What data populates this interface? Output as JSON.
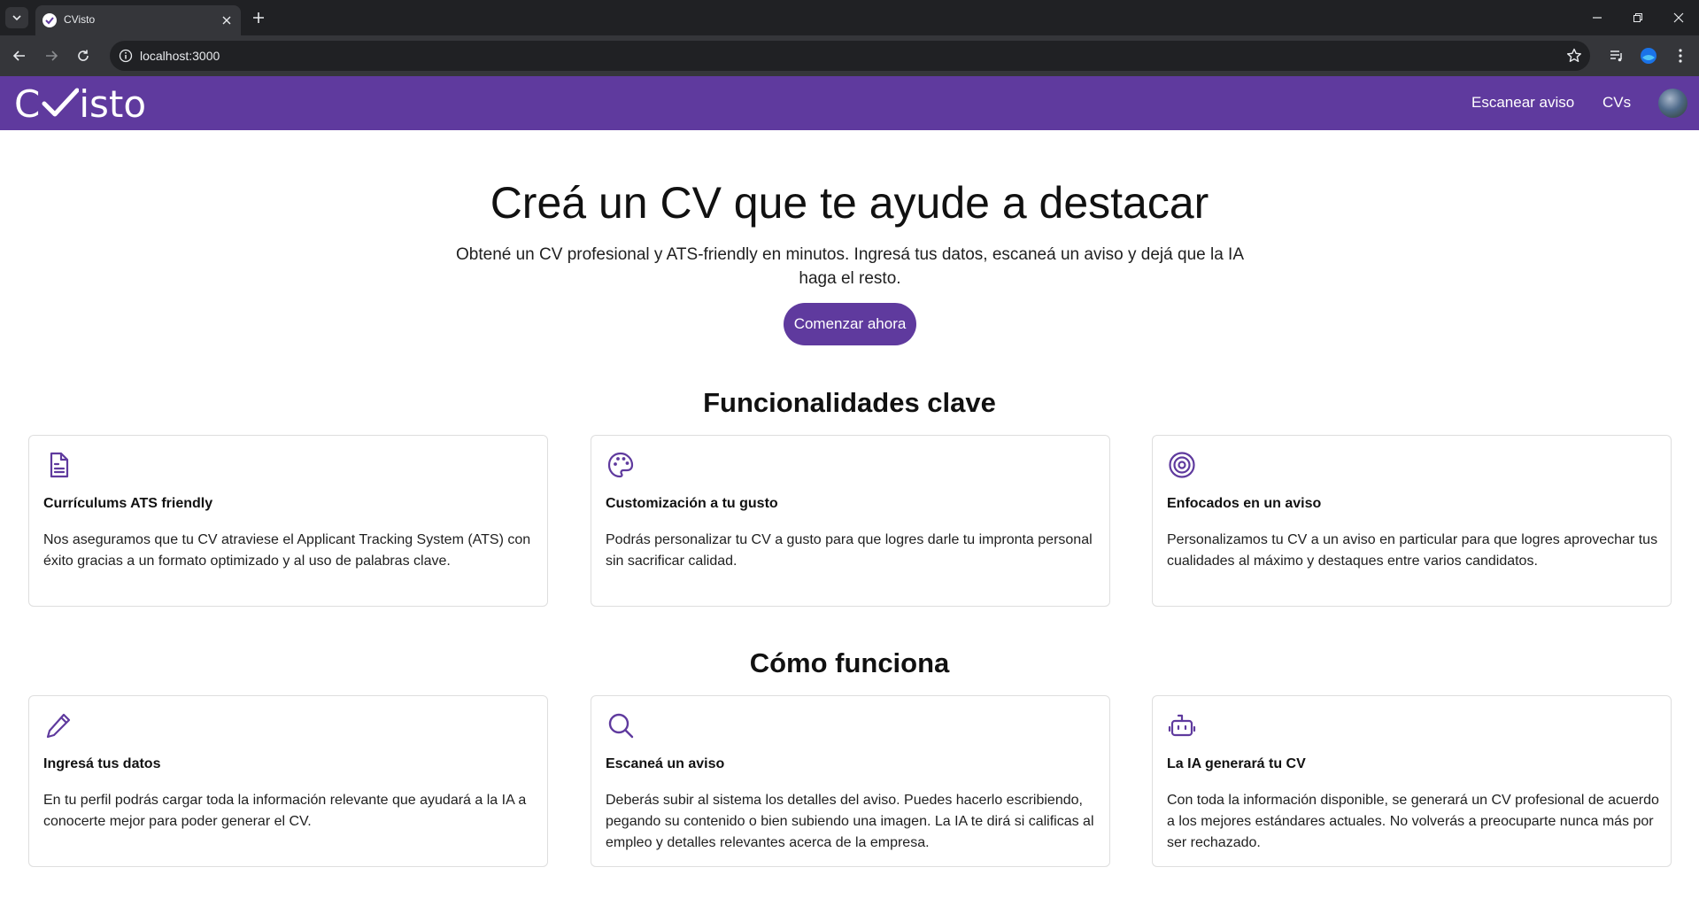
{
  "browser": {
    "tab_title": "CVisto",
    "url": "localhost:3000"
  },
  "header": {
    "logo_c": "C",
    "logo_rest": "isto",
    "nav": {
      "scan": "Escanear aviso",
      "cvs": "CVs"
    }
  },
  "hero": {
    "title": "Creá un CV que te ayude a destacar",
    "subtitle": "Obtené un CV profesional y ATS-friendly en minutos. Ingresá tus datos, escaneá un aviso y dejá que la IA haga el resto.",
    "cta": "Comenzar ahora"
  },
  "features": {
    "title": "Funcionalidades clave",
    "items": [
      {
        "icon": "document-icon",
        "title": "Currículums ATS friendly",
        "text": "Nos aseguramos que tu CV atraviese el Applicant Tracking System (ATS) con éxito gracias a un formato optimizado y al uso de palabras clave."
      },
      {
        "icon": "palette-icon",
        "title": "Customización a tu gusto",
        "text": "Podrás personalizar tu CV a gusto para que logres darle tu impronta personal sin sacrificar calidad."
      },
      {
        "icon": "target-icon",
        "title": "Enfocados en un aviso",
        "text": "Personalizamos tu CV a un aviso en particular para que logres aprovechar tus cualidades al máximo y destaques entre varios candidatos."
      }
    ]
  },
  "how": {
    "title": "Cómo funciona",
    "items": [
      {
        "icon": "pencil-icon",
        "title": "Ingresá tus datos",
        "text": "En tu perfil podrás cargar toda la información relevante que ayudará a la IA a conocerte mejor para poder generar el CV."
      },
      {
        "icon": "search-icon",
        "title": "Escaneá un aviso",
        "text": "Deberás subir al sistema los detalles del aviso. Puedes hacerlo escribiendo, pegando su contenido o bien subiendo una imagen. La IA te dirá si calificas al empleo y detalles relevantes acerca de la empresa."
      },
      {
        "icon": "robot-icon",
        "title": "La IA generará tu CV",
        "text": "Con toda la información disponible, se generará un CV profesional de acuerdo a los mejores estándares actuales. No volverás a preocuparte nunca más por ser rechazado."
      }
    ]
  },
  "colors": {
    "brand": "#5f3a9e",
    "chrome_dark": "#202124",
    "chrome_mid": "#35363a"
  }
}
